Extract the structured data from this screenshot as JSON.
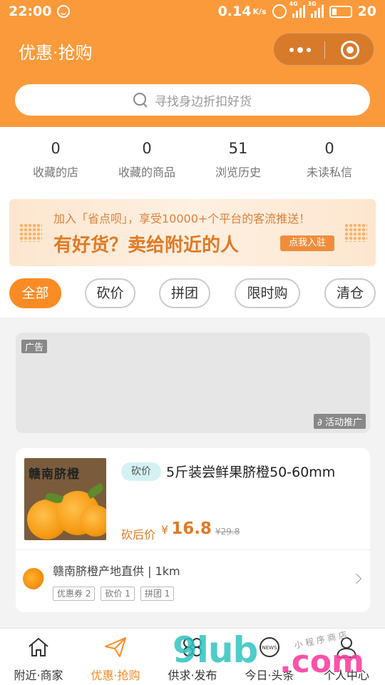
{
  "status_bar": {
    "time": "22:00",
    "speed": "0.14",
    "speed_unit": "K/s",
    "network_1": "4G",
    "network_2": "3G",
    "battery": "20"
  },
  "header": {
    "title": "优惠·抢购"
  },
  "search": {
    "placeholder": "寻找身边折扣好货"
  },
  "stats": [
    {
      "value": "0",
      "label": "收藏的店"
    },
    {
      "value": "0",
      "label": "收藏的商品"
    },
    {
      "value": "51",
      "label": "浏览历史"
    },
    {
      "value": "0",
      "label": "未读私信"
    }
  ],
  "promo_banner": {
    "line1": "加入「省点呗」，享受10000+个平台的客流推送！",
    "line2": "有好货？卖给附近的人",
    "button": "点我入驻"
  },
  "filters": [
    {
      "label": "全部",
      "active": true
    },
    {
      "label": "砍价",
      "active": false
    },
    {
      "label": "拼团",
      "active": false
    },
    {
      "label": "限时购",
      "active": false
    },
    {
      "label": "清仓",
      "active": false
    }
  ],
  "ad": {
    "tag": "广告",
    "promo_label": "活动推广"
  },
  "product": {
    "image_title": "赣南脐橙",
    "tag": "砍价",
    "name": "5斤装尝鲜果脐橙50-60mm",
    "price_label": "砍后价",
    "currency": "¥",
    "price": "16.8",
    "original_price": "¥29.8",
    "shop_name": "赣南脐橙产地直供 | 1km",
    "shop_tags": [
      "优惠券 2",
      "砍价 1",
      "拼团 1"
    ]
  },
  "tabbar": [
    {
      "label": "附近·商家",
      "icon": "home-icon",
      "active": false
    },
    {
      "label": "优惠·抢购",
      "icon": "paper-plane-icon",
      "active": true
    },
    {
      "label": "供求·发布",
      "icon": "grid-icon",
      "active": false
    },
    {
      "label": "今日·头条",
      "icon": "news-icon",
      "active": false
    },
    {
      "label": "个人中心",
      "icon": "user-icon",
      "active": false
    }
  ],
  "watermark": {
    "brand": "9lub",
    "domain": ".com",
    "small_text": "小 程 序 商 店"
  },
  "colors": {
    "primary": "#fb9a3b",
    "accent": "#fb8b24",
    "price": "#e07a25",
    "tag_bg": "#d4f1f4"
  }
}
